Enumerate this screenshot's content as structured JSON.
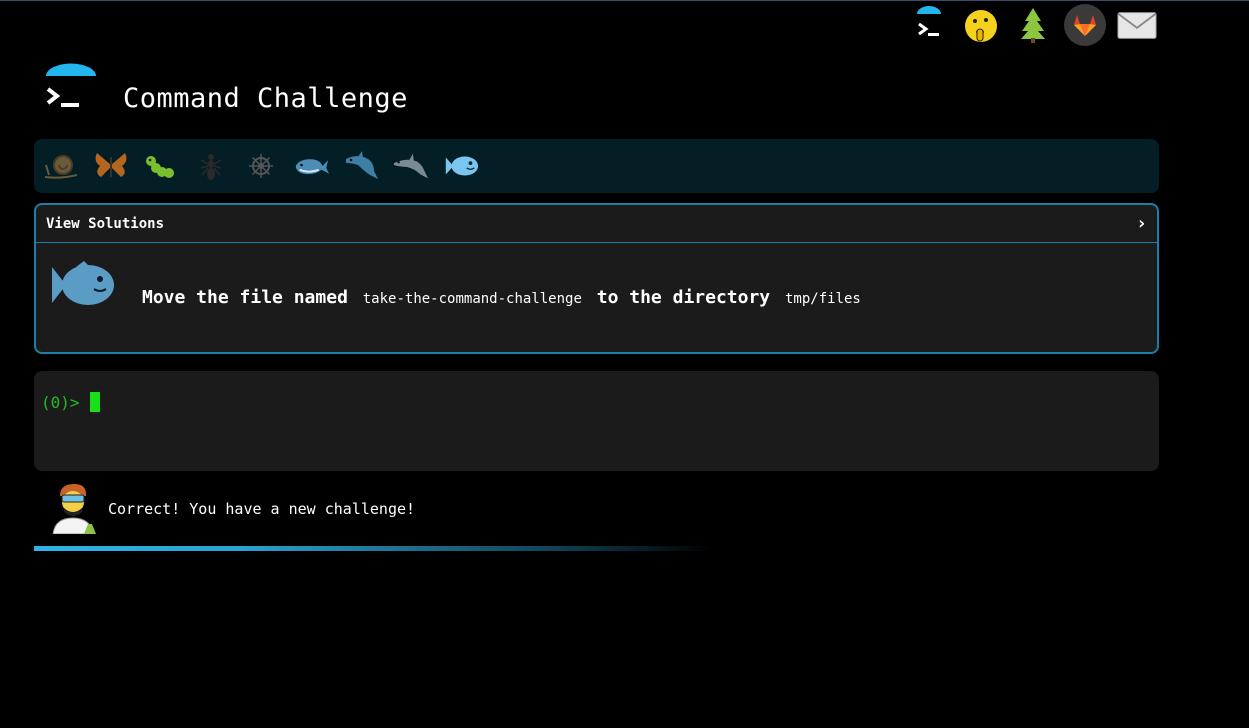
{
  "app": {
    "title": "Command Challenge"
  },
  "nav": {
    "icons": [
      "terminal-icon",
      "shushing-face-icon",
      "evergreen-tree-icon",
      "gitlab-icon",
      "envelope-icon"
    ]
  },
  "levels": [
    "snail-icon",
    "butterfly-icon",
    "caterpillar-icon",
    "ant-icon",
    "ship-wheel-icon",
    "whale-icon",
    "dolphin-icon",
    "dolphin-icon",
    "fish-icon"
  ],
  "panel": {
    "header": "View Solutions",
    "chevron": "›",
    "task_prefix": "Move the file named",
    "task_file": "take-the-command-challenge",
    "task_mid": "to the directory",
    "task_dir": "tmp/files"
  },
  "terminal": {
    "prompt": "(0)>"
  },
  "message": {
    "text": "Correct! You have a new challenge!"
  },
  "colors": {
    "accent": "#1e7ea5",
    "prompt_green": "#1fbf1f",
    "bar_bg": "#041e26"
  }
}
